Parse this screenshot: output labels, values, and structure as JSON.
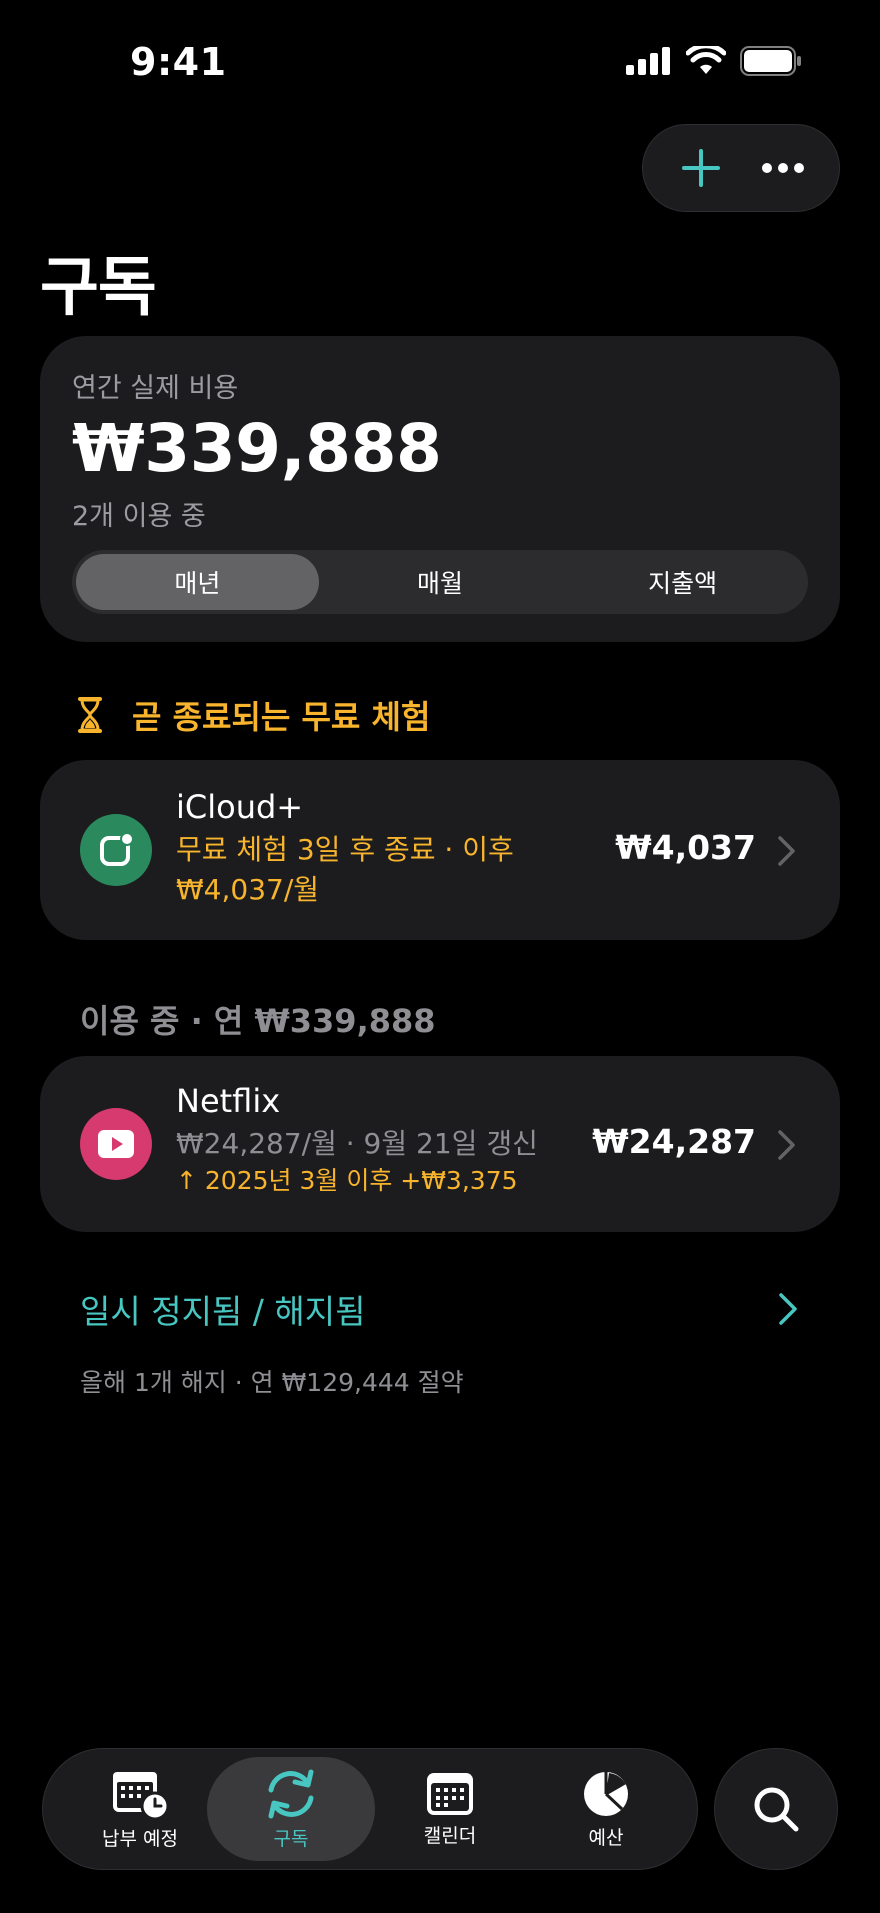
{
  "status": {
    "time": "9:41"
  },
  "page": {
    "title": "구독"
  },
  "summary": {
    "label": "연간 실제 비용",
    "amount": "₩339,888",
    "sub": "2개 이용 중",
    "segments": [
      "매년",
      "매월",
      "지출액"
    ],
    "selected_segment": "매년"
  },
  "trial_section": {
    "header": "곧 종료되는 무료 체험",
    "items": [
      {
        "name": "iCloud+",
        "desc_line1": "무료 체험 3일 후 종료 · 이후",
        "desc_line2": "₩4,037/월",
        "price": "₩4,037",
        "icon": "icloud-app-icon",
        "icon_color": "#2a8a5e"
      }
    ]
  },
  "active_section": {
    "label": "이용 중 · 연 ₩339,888",
    "items": [
      {
        "name": "Netflix",
        "desc_line1": "₩24,287/월 · 9월 21일 갱신",
        "desc_line2": "↑ 2025년 3월 이후 +₩3,375",
        "price": "₩24,287",
        "icon": "play-icon",
        "icon_color": "#d63a6e"
      }
    ]
  },
  "paused": {
    "link": "일시 정지됨 / 해지됨",
    "note": "올해 1개 해지 · 연 ₩129,444 절약"
  },
  "tabs": [
    {
      "label": "납부 예정",
      "icon": "calendar-clock-icon",
      "active": false
    },
    {
      "label": "구독",
      "icon": "sync-icon",
      "active": true
    },
    {
      "label": "캘린더",
      "icon": "calendar-icon",
      "active": false
    },
    {
      "label": "예산",
      "icon": "pie-chart-icon",
      "active": false
    }
  ],
  "colors": {
    "accent": "#48c6c1",
    "warning": "#f7b42c",
    "card": "#1c1c1e",
    "secondary_text": "#8e8e93"
  }
}
